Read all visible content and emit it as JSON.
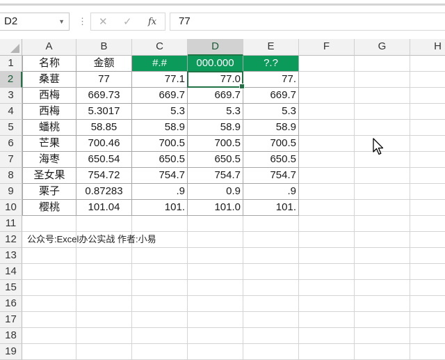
{
  "formula_bar": {
    "name_box": "D2",
    "name_box_dropdown_icon": "chevron-down-icon",
    "separator": "⋮",
    "cancel_icon": "✕",
    "enter_icon": "✓",
    "fx_label": "fx",
    "formula_value": "77"
  },
  "columns": [
    "A",
    "B",
    "C",
    "D",
    "E",
    "F",
    "G",
    "H"
  ],
  "rows": [
    "1",
    "2",
    "3",
    "4",
    "5",
    "6",
    "7",
    "8",
    "9",
    "10",
    "11",
    "12",
    "13",
    "14",
    "15",
    "16",
    "17",
    "18",
    "19"
  ],
  "table": {
    "headers": [
      "名称",
      "金额",
      "#.#",
      "000.000",
      "?.?"
    ],
    "rows": [
      [
        "桑葚",
        "77",
        "77.1",
        "77.0",
        "77."
      ],
      [
        "西梅",
        "669.73",
        "669.7",
        "669.7",
        "669.7"
      ],
      [
        "西梅",
        "5.3017",
        "5.3",
        "5.3",
        "5.3"
      ],
      [
        "蟠桃",
        "58.85",
        "58.9",
        "58.9",
        "58.9"
      ],
      [
        "芒果",
        "700.46",
        "700.5",
        "700.5",
        "700.5"
      ],
      [
        "海枣",
        "650.54",
        "650.5",
        "650.5",
        "650.5"
      ],
      [
        "圣女果",
        "754.72",
        "754.7",
        "754.7",
        "754.7"
      ],
      [
        "栗子",
        "0.87283",
        ".9",
        "0.9",
        ".9"
      ],
      [
        "樱桃",
        "101.04",
        "101.",
        "101.0",
        "101."
      ]
    ]
  },
  "note": "公众号:Excel办公实战  作者:小易",
  "colors": {
    "header_green": "#0c9a5a",
    "selection_green": "#217346"
  },
  "cursor_icon": "mouse-pointer-icon"
}
